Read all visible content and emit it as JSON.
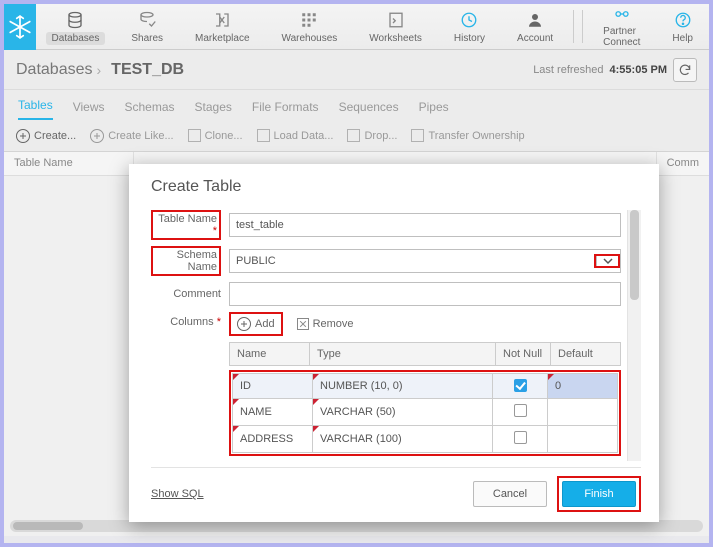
{
  "toolbar": {
    "items": [
      {
        "label": "Databases"
      },
      {
        "label": "Shares"
      },
      {
        "label": "Marketplace"
      },
      {
        "label": "Warehouses"
      },
      {
        "label": "Worksheets"
      },
      {
        "label": "History"
      },
      {
        "label": "Account"
      }
    ],
    "right": [
      {
        "label": "Partner Connect"
      },
      {
        "label": "Help"
      }
    ]
  },
  "breadcrumb": {
    "root": "Databases",
    "current": "TEST_DB",
    "refresh_label": "Last refreshed",
    "refresh_time": "4:55:05 PM"
  },
  "tabs": [
    "Tables",
    "Views",
    "Schemas",
    "Stages",
    "File Formats",
    "Sequences",
    "Pipes"
  ],
  "actions": [
    "Create...",
    "Create Like...",
    "Clone...",
    "Load Data...",
    "Drop...",
    "Transfer Ownership"
  ],
  "back_table": {
    "col_name": "Table Name",
    "col_comm": "Comm"
  },
  "modal": {
    "title": "Create Table",
    "labels": {
      "table_name": "Table Name",
      "schema_name": "Schema Name",
      "comment": "Comment",
      "columns": "Columns"
    },
    "values": {
      "table_name": "test_table",
      "schema_name": "PUBLIC",
      "comment": ""
    },
    "col_buttons": {
      "add": "Add",
      "remove": "Remove"
    },
    "grid": {
      "headers": {
        "name": "Name",
        "type": "Type",
        "notnull": "Not Null",
        "default": "Default"
      },
      "rows": [
        {
          "name": "ID",
          "type": "NUMBER (10, 0)",
          "notnull": true,
          "default": "0"
        },
        {
          "name": "NAME",
          "type": "VARCHAR (50)",
          "notnull": false,
          "default": ""
        },
        {
          "name": "ADDRESS",
          "type": "VARCHAR (100)",
          "notnull": false,
          "default": ""
        }
      ]
    },
    "footer": {
      "show_sql": "Show SQL",
      "cancel": "Cancel",
      "finish": "Finish"
    }
  }
}
